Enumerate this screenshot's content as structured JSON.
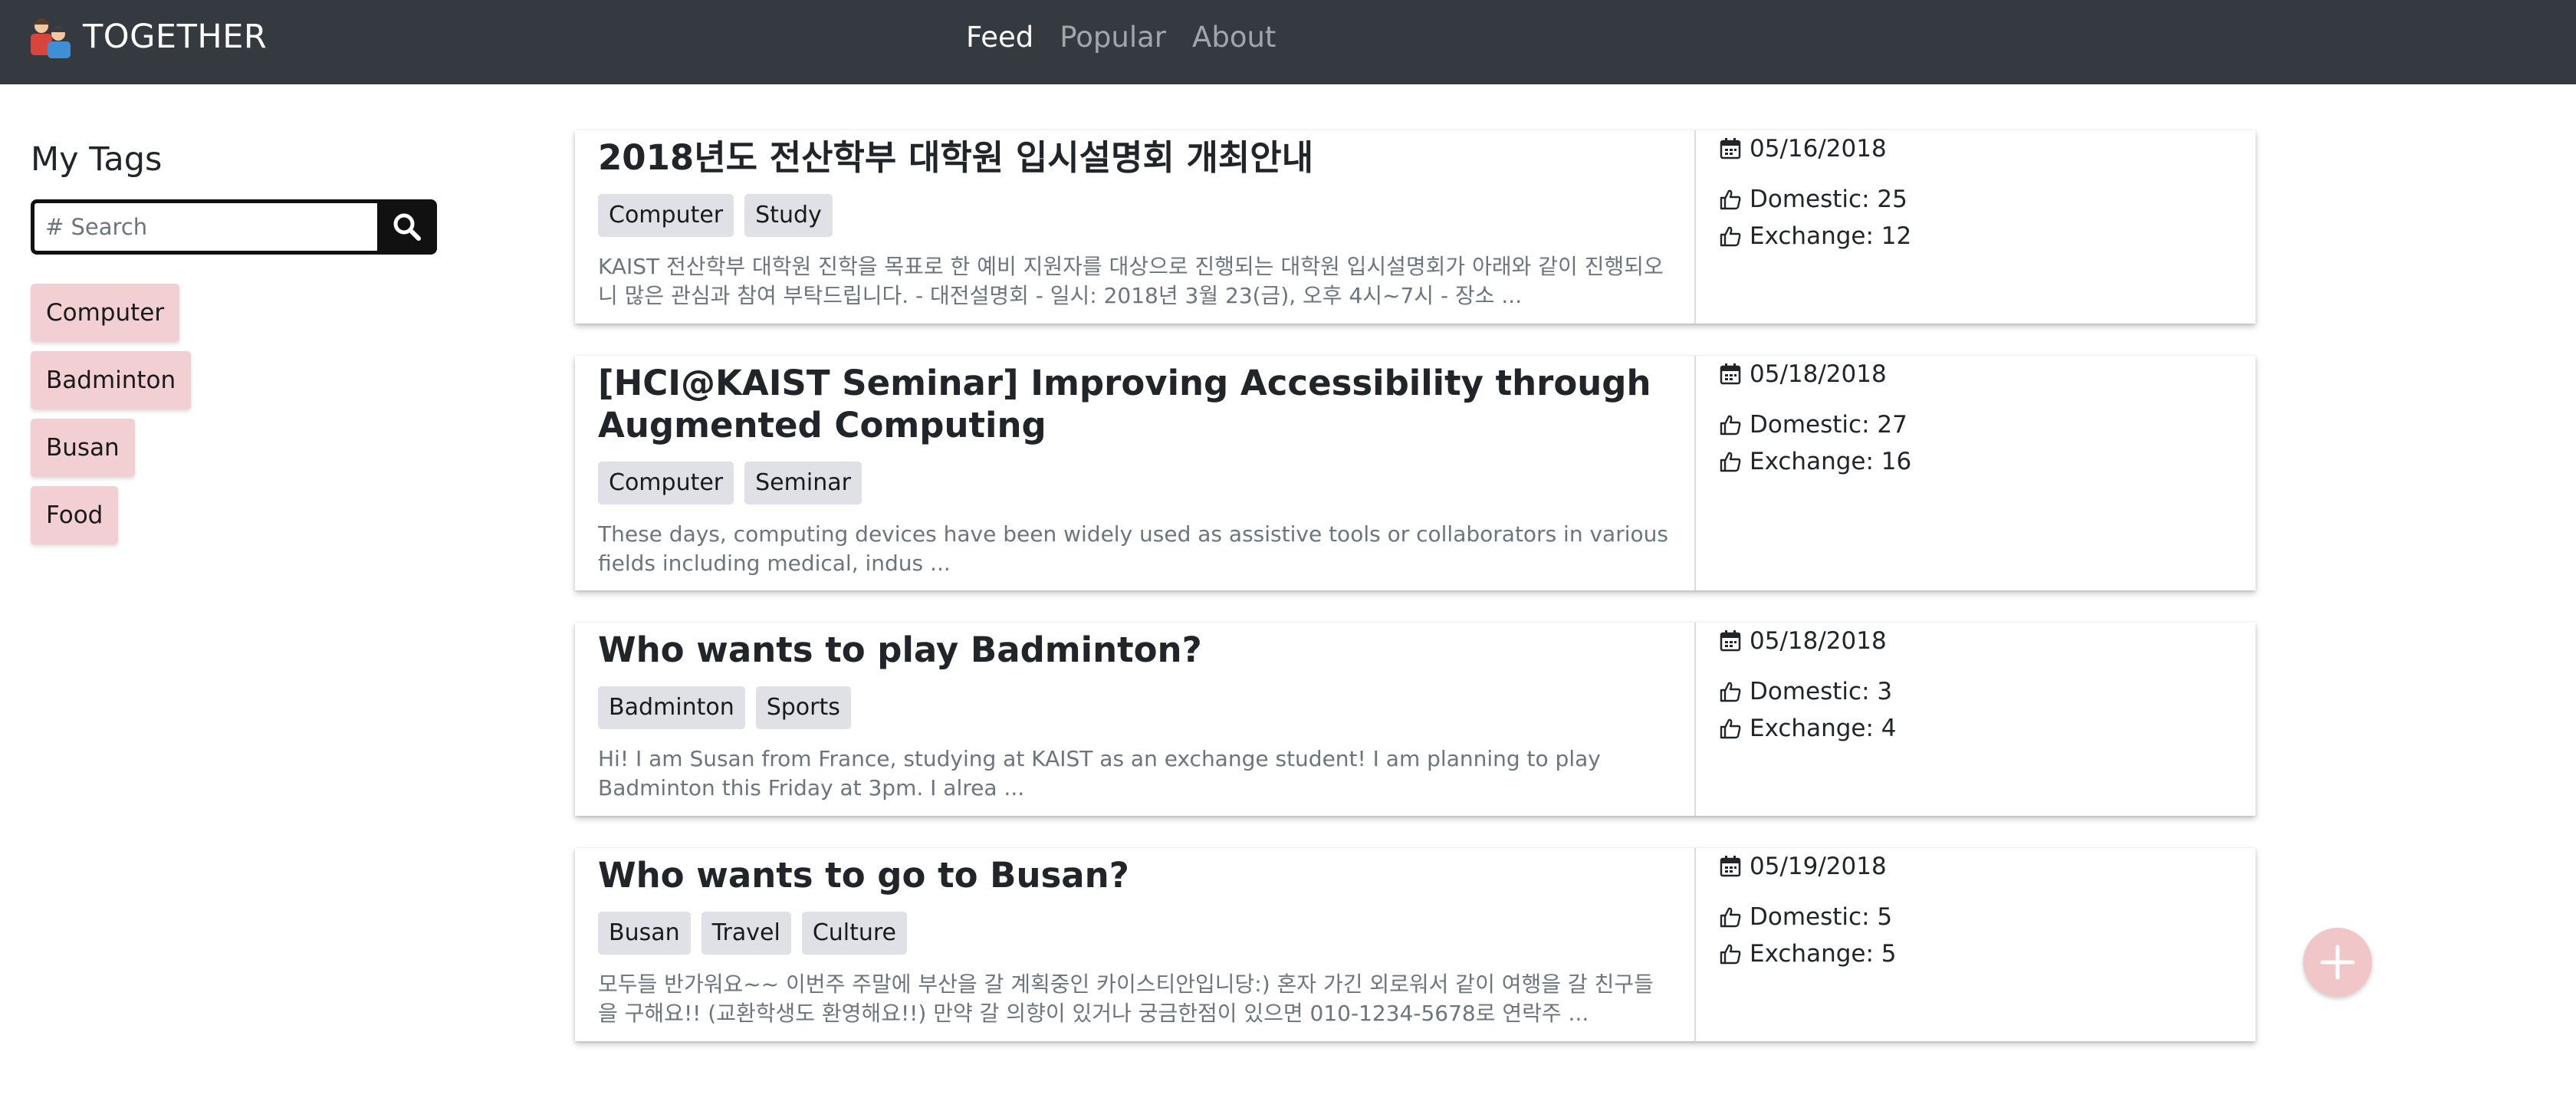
{
  "app": {
    "brand": "TOGETHER"
  },
  "nav": {
    "items": [
      "Feed",
      "Popular",
      "About"
    ],
    "active": "Feed"
  },
  "sidebar": {
    "title": "My Tags",
    "search_placeholder": "# Search",
    "tags": [
      "Computer",
      "Badminton",
      "Busan",
      "Food"
    ]
  },
  "posts": [
    {
      "title": "2018년도 전산학부 대학원 입시설명회 개최안내",
      "tags": [
        "Computer",
        "Study"
      ],
      "excerpt": "KAIST 전산학부 대학원 진학을 목표로 한 예비 지원자를 대상으로 진행되는 대학원 입시설명회가 아래와 같이 진행되오니 많은 관심과 참여 부탁드립니다. - 대전설명회 - 일시: 2018년 3월 23(금), 오후 4시~7시 - 장소 ...",
      "date": "05/16/2018",
      "domestic": "Domestic: 25",
      "exchange": "Exchange: 12"
    },
    {
      "title": "[HCI@KAIST Seminar] Improving Accessibility through Augmented Computing",
      "tags": [
        "Computer",
        "Seminar"
      ],
      "excerpt": "These days, computing devices have been widely used as assistive tools or collaborators in various fields including medical, indus ...",
      "date": "05/18/2018",
      "domestic": "Domestic: 27",
      "exchange": "Exchange: 16"
    },
    {
      "title": "Who wants to play Badminton?",
      "tags": [
        "Badminton",
        "Sports"
      ],
      "excerpt": "Hi! I am Susan from France, studying at KAIST as an exchange student! I am planning to play Badminton this Friday at 3pm. I alrea ...",
      "date": "05/18/2018",
      "domestic": "Domestic: 3",
      "exchange": "Exchange: 4"
    },
    {
      "title": "Who wants to go to Busan?",
      "tags": [
        "Busan",
        "Travel",
        "Culture"
      ],
      "excerpt": "모두들 반가워요~~ 이번주 주말에 부산을 갈 계획중인 카이스티안입니당:) 혼자 가긴 외로워서 같이 여행을 갈 친구들을 구해요!! (교환학생도 환영해요!!) 만약 갈 의향이 있거나 궁금한점이 있으면 010-1234-5678로 연락주 ...",
      "date": "05/19/2018",
      "domestic": "Domestic: 5",
      "exchange": "Exchange: 5"
    }
  ],
  "icons": {
    "logo": "people-logo-icon",
    "search": "search-icon",
    "date": "calendar-icon",
    "like": "thumbs-up-icon",
    "fab": "plus-icon"
  },
  "colors": {
    "navbar": "#343a40",
    "side_tag": "#f2cfd2",
    "post_tag": "#e0e1e6",
    "fab": "#f0c6c9"
  }
}
